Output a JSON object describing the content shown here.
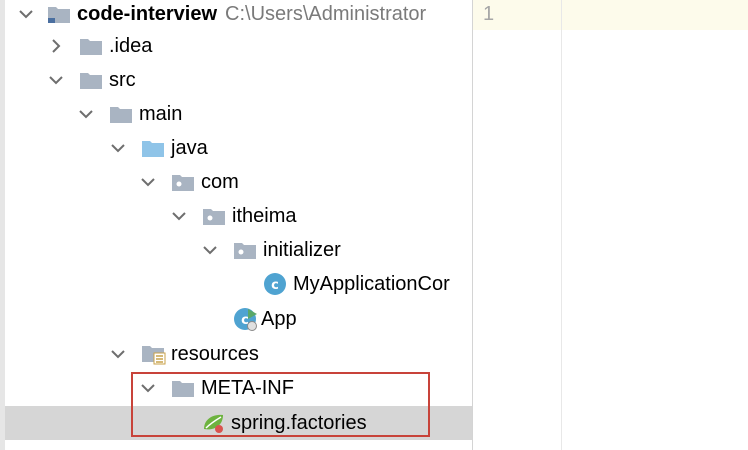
{
  "project_tree": {
    "root": {
      "label": "code-interview",
      "path_hint": "C:\\Users\\Administrator"
    },
    "items": [
      {
        "key": "idea",
        "label": ".idea"
      },
      {
        "key": "src",
        "label": "src"
      },
      {
        "key": "main",
        "label": "main"
      },
      {
        "key": "java",
        "label": "java"
      },
      {
        "key": "com",
        "label": "com"
      },
      {
        "key": "itheima",
        "label": "itheima"
      },
      {
        "key": "initializer",
        "label": "initializer"
      },
      {
        "key": "myapplicationcontextinitializer",
        "label": "MyApplicationCor"
      },
      {
        "key": "app",
        "label": "App"
      },
      {
        "key": "resources",
        "label": "resources"
      },
      {
        "key": "meta_inf",
        "label": "META-INF"
      },
      {
        "key": "spring_factories",
        "label": "spring.factories"
      }
    ],
    "selected_item": "spring.factories"
  },
  "editor": {
    "line_number": "1"
  },
  "colors": {
    "selection": "#d6d6d6",
    "highlight_border": "#c8433a",
    "folder": "#a9b4c2",
    "source_folder": "#8fc4e8",
    "class_badge": "#4fa3d1",
    "spring_leaf": "#6db33f"
  }
}
